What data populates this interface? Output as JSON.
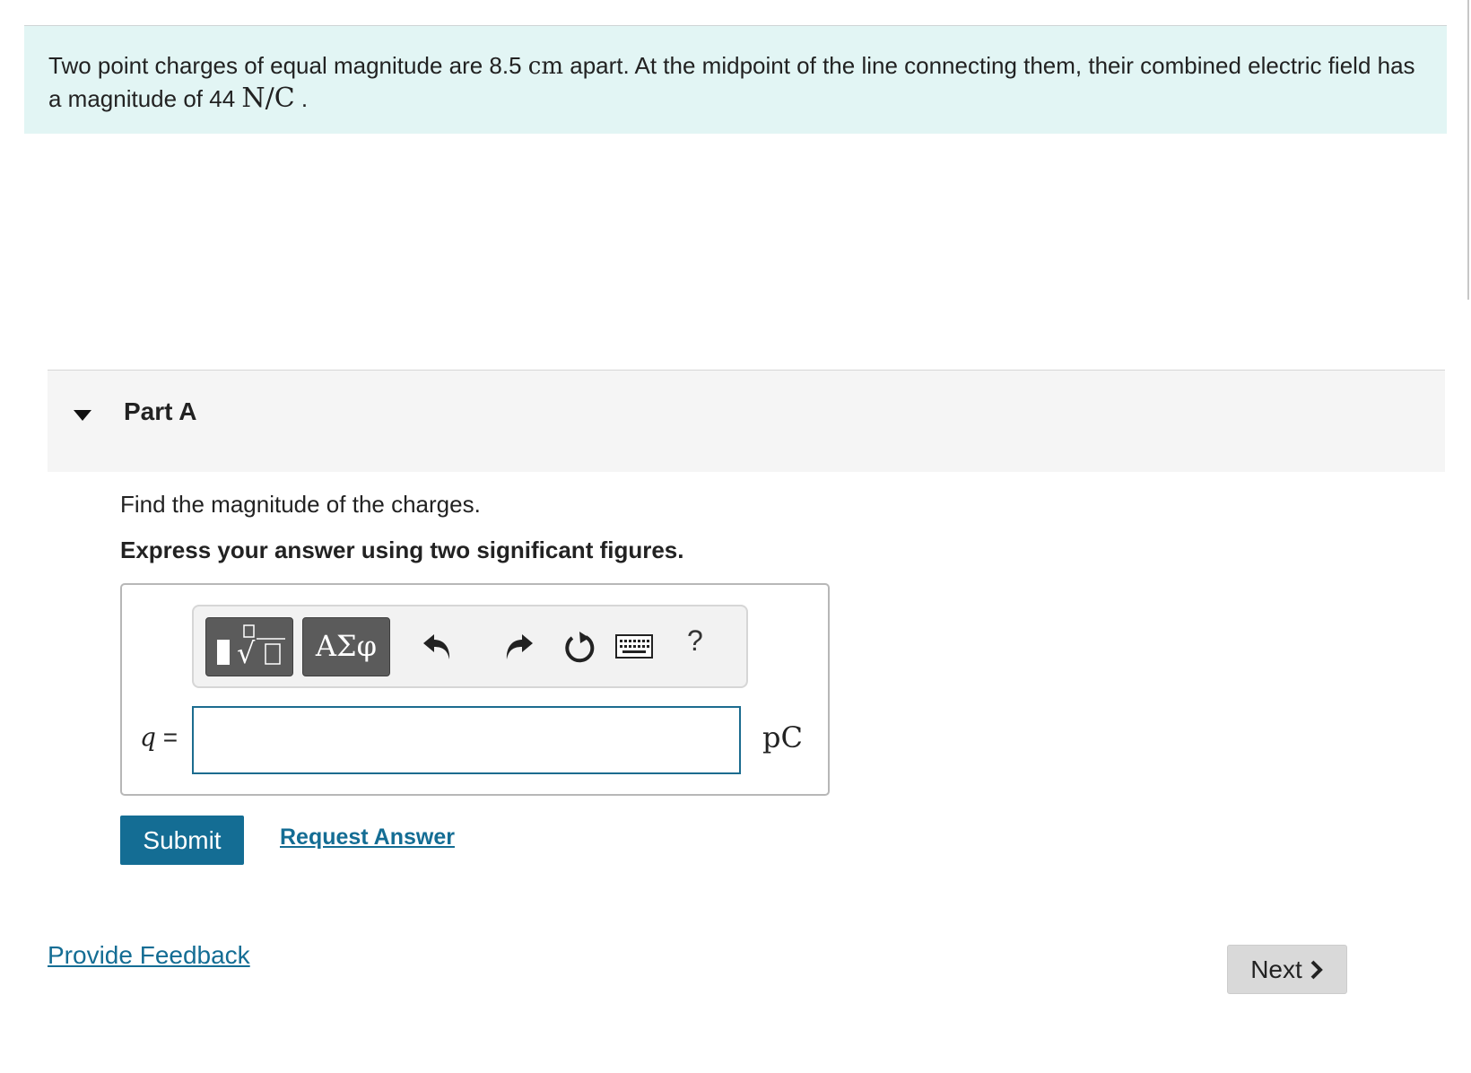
{
  "problem": {
    "text_before_distance": "Two point charges of equal magnitude are 8.5 ",
    "distance_unit": "cm",
    "text_after_distance": " apart. At the midpoint of the line connecting them, their combined electric field has a magnitude of 44 ",
    "field_unit": "N/C",
    "text_end": " ."
  },
  "part": {
    "title": "Part A",
    "prompt": "Find the magnitude of the charges.",
    "instruction": "Express your answer using two significant figures."
  },
  "answer": {
    "variable": "q",
    "equals": "=",
    "value": "",
    "unit": "pC"
  },
  "toolbar": {
    "greek_label": "ΑΣφ",
    "help_label": "?",
    "icons": [
      "templates-icon",
      "greek-letters-icon",
      "undo-icon",
      "redo-icon",
      "reset-icon",
      "keyboard-icon",
      "help-icon"
    ]
  },
  "actions": {
    "submit_label": "Submit",
    "request_answer_label": "Request Answer",
    "provide_feedback_label": "Provide Feedback",
    "next_label": "Next"
  },
  "colors": {
    "intro_background": "#e2f5f4",
    "primary": "#146d94",
    "input_border": "#1c6c8f",
    "toolbar_button": "#5b5b5b",
    "next_background": "#d9d9d9"
  }
}
